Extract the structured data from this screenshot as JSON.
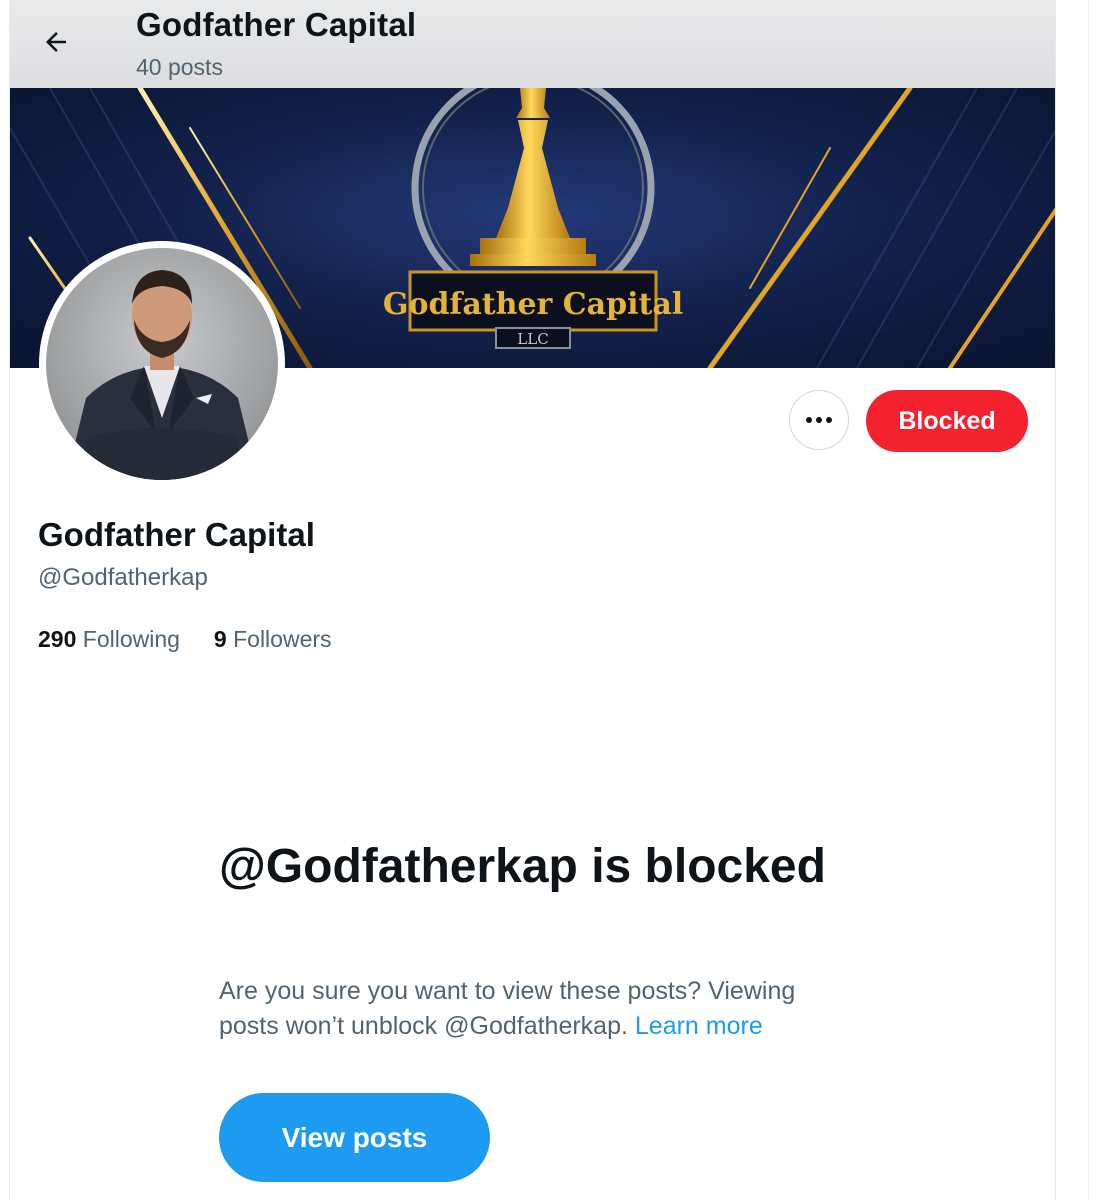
{
  "header": {
    "title": "Godfather Capital",
    "subtitle": "40 posts",
    "back_icon": "arrow-left-icon"
  },
  "banner": {
    "logo_text": "Godfather Capital",
    "logo_subtext": "LLC",
    "colors": {
      "background": "#13224d",
      "gold": "#e0a526"
    }
  },
  "profile": {
    "name": "Godfather Capital",
    "handle": "@Godfatherkap",
    "following_count": "290",
    "following_label": "Following",
    "followers_count": "9",
    "followers_label": "Followers"
  },
  "actions": {
    "more_icon": "more-horizontal-icon",
    "blocked_label": "Blocked",
    "blocked_color": "#f4212e"
  },
  "blocked_notice": {
    "heading": "@Godfatherkap is blocked",
    "body": "Are you sure you want to view these posts? Viewing posts won’t unblock @Godfatherkap.",
    "link_text": "Learn more",
    "button_label": "View posts",
    "button_color": "#1d9bf0",
    "link_color": "#1d9bf0"
  }
}
